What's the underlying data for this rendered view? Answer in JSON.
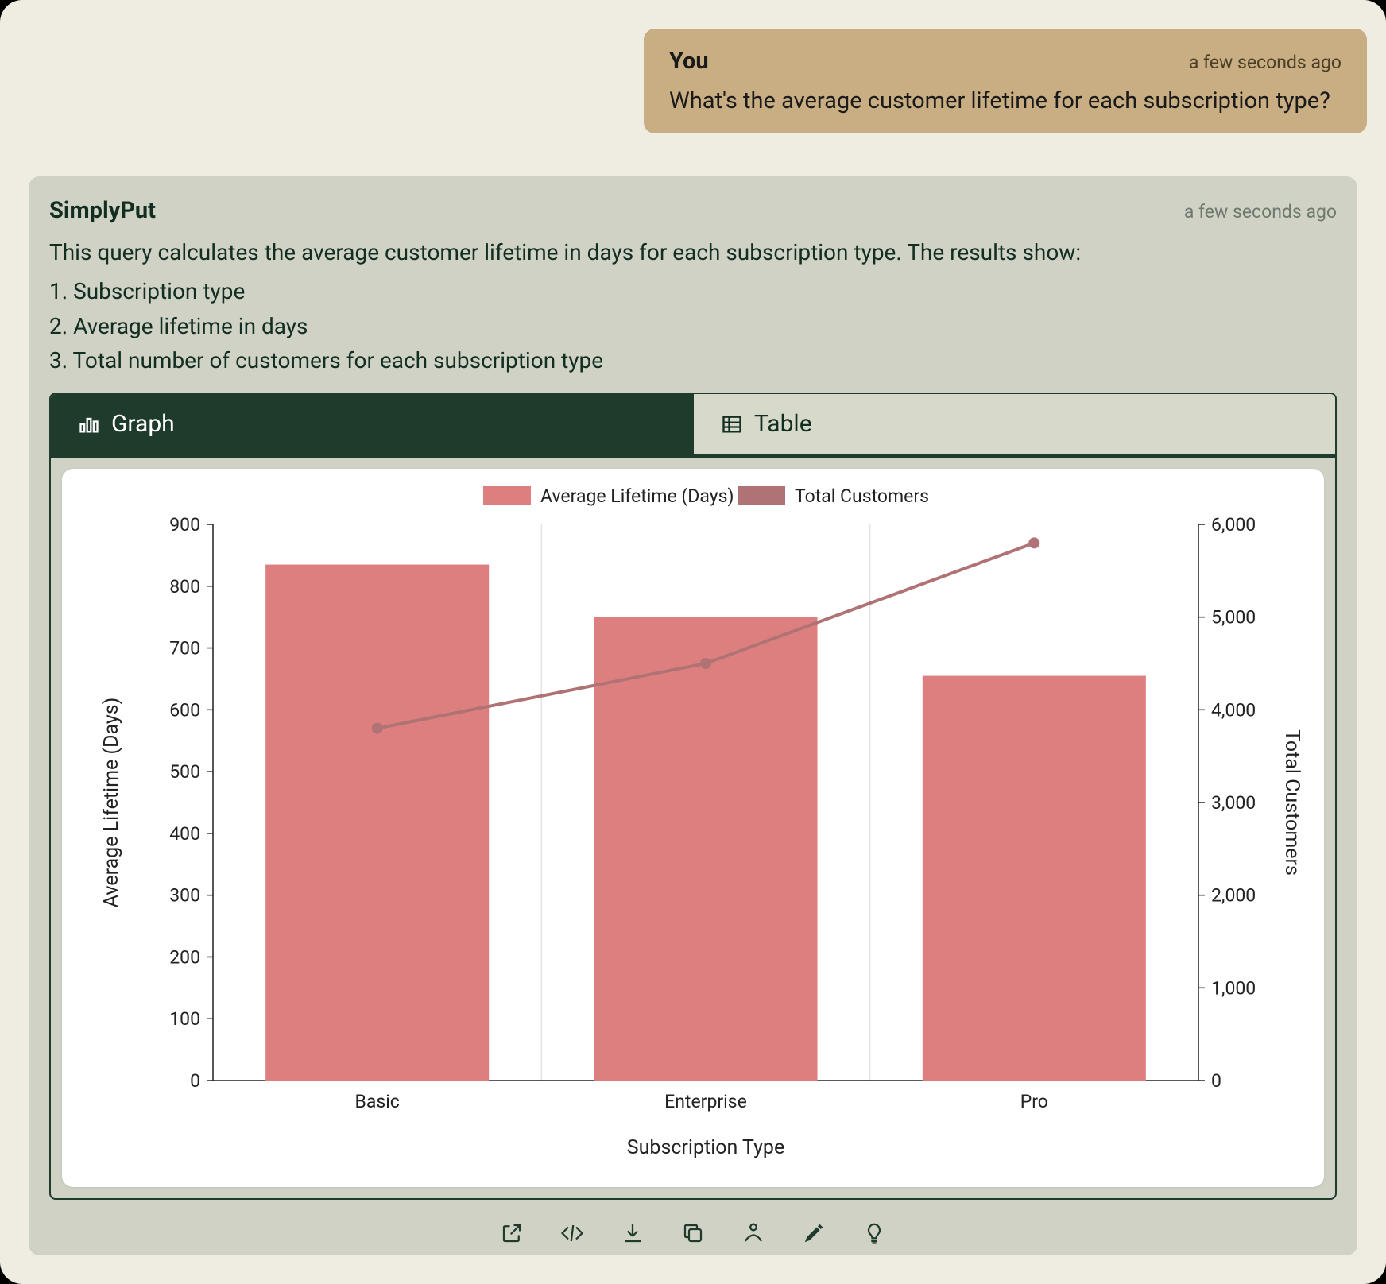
{
  "user": {
    "who": "You",
    "when": "a few seconds ago",
    "body": "What's the average customer lifetime for each subscription type?"
  },
  "assistant": {
    "who": "SimplyPut",
    "when": "a few seconds ago",
    "summary": "This query calculates the average customer lifetime in days for each subscription type. The results show:",
    "items": [
      "1. Subscription type",
      "2. Average lifetime in days",
      "3. Total number of customers for each subscription type"
    ]
  },
  "tabs": {
    "graph": "Graph",
    "table": "Table"
  },
  "toolbar": {
    "open": "Open",
    "code": "Code",
    "download": "Download",
    "copy": "Copy",
    "present": "Present",
    "edit": "Edit chart",
    "hint": "Hint"
  },
  "chart_data": {
    "type": "bar",
    "categories": [
      "Basic",
      "Enterprise",
      "Pro"
    ],
    "series": [
      {
        "name": "Average Lifetime (Days)",
        "type": "bar",
        "values": [
          835,
          750,
          655
        ],
        "axis": "left",
        "color": "#dd7f7f"
      },
      {
        "name": "Total Customers",
        "type": "line",
        "values": [
          3800,
          4500,
          5800
        ],
        "axis": "right",
        "color": "#b07375"
      }
    ],
    "xlabel": "Subscription Type",
    "ylabel_left": "Average Lifetime (Days)",
    "ylabel_right": "Total Customers",
    "ylim_left": [
      0,
      900
    ],
    "ylim_right": [
      0,
      6000
    ],
    "yticks_left": [
      0,
      100,
      200,
      300,
      400,
      500,
      600,
      700,
      800,
      900
    ],
    "yticks_right": [
      0,
      1000,
      2000,
      3000,
      4000,
      5000,
      6000
    ]
  }
}
